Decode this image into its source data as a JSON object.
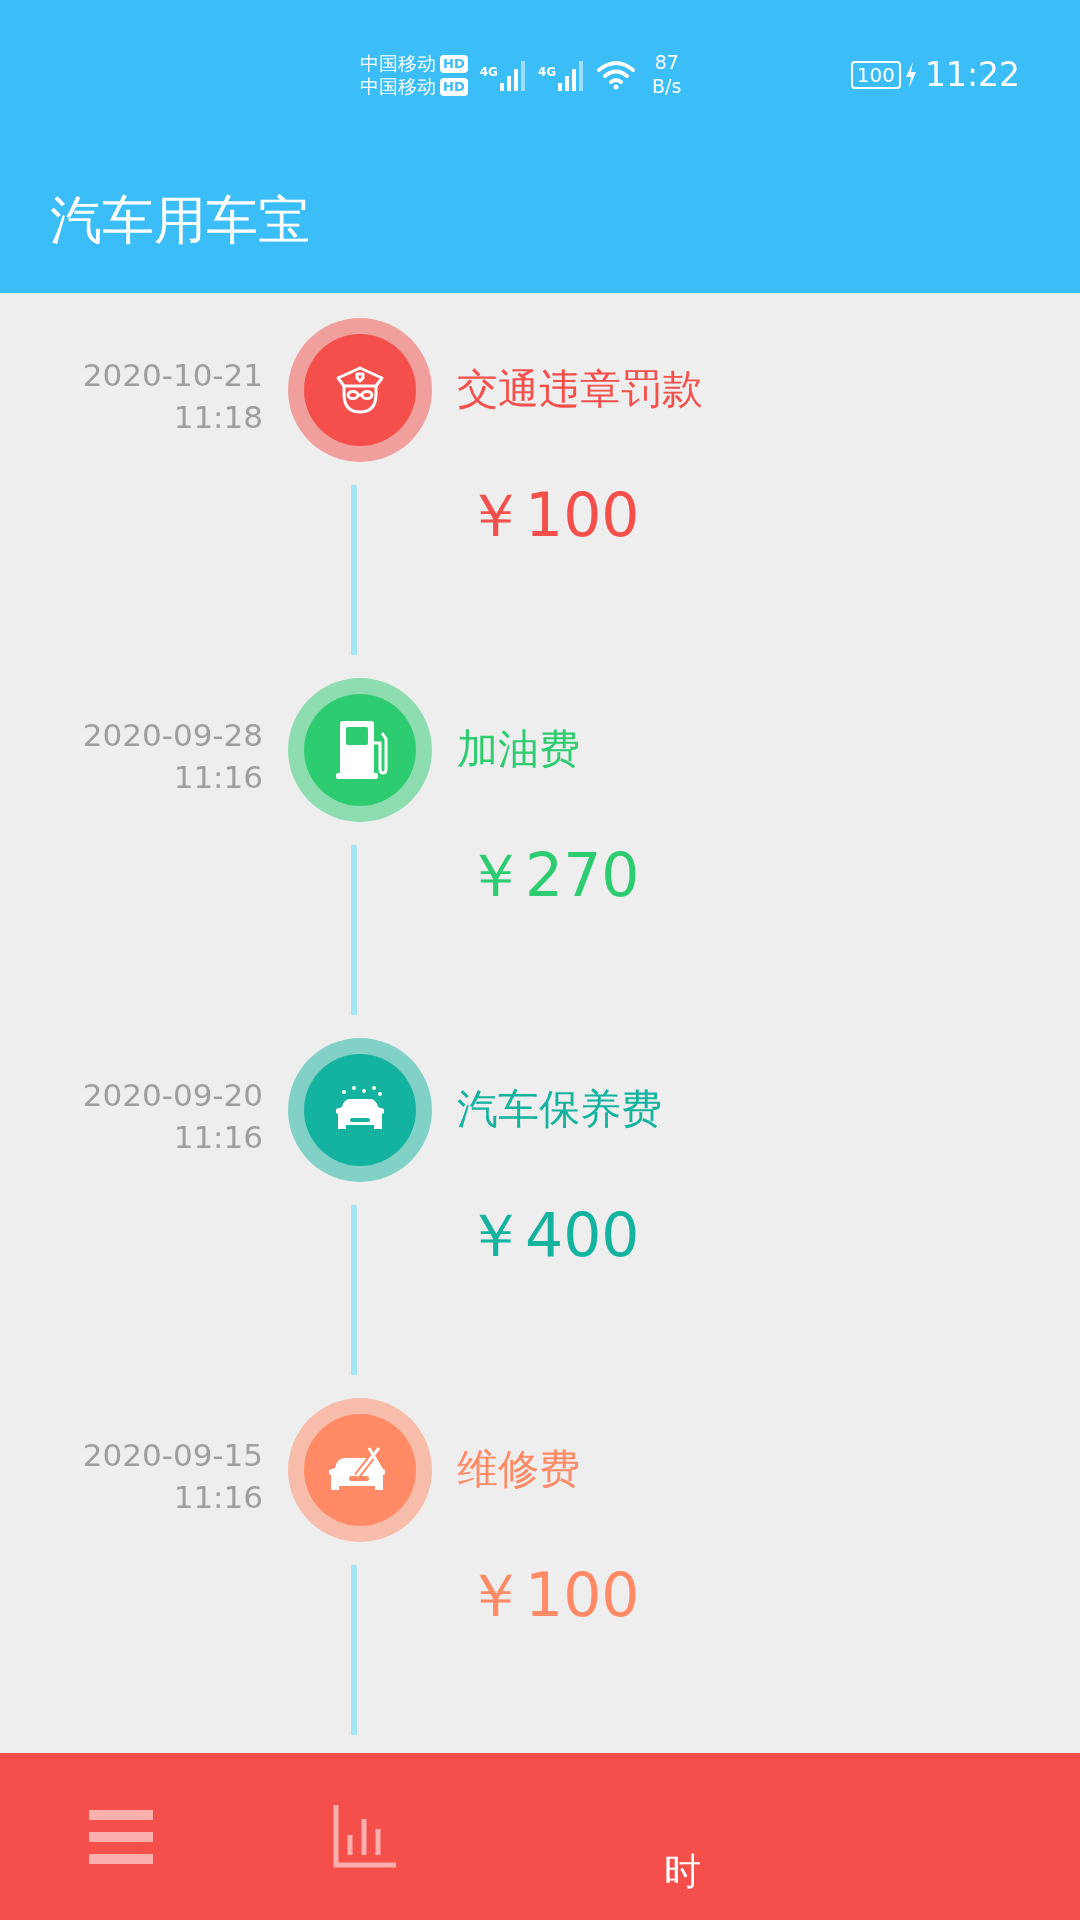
{
  "status_bar": {
    "carriers": [
      {
        "name": "中国移动",
        "badge": "HD"
      },
      {
        "name": "中国移动",
        "badge": "HD"
      }
    ],
    "networks": [
      "4G",
      "4G"
    ],
    "speed_value": "87",
    "speed_unit": "B/s",
    "battery": "100",
    "time": "11:22"
  },
  "app_bar": {
    "title": "汽车用车宝"
  },
  "timeline": [
    {
      "kind": "fine",
      "date": "2020-10-21",
      "time": "11:18",
      "title": "交通违章罚款",
      "amount": "￥100",
      "color": "#f44f4a"
    },
    {
      "kind": "fuel",
      "date": "2020-09-28",
      "time": "11:16",
      "title": "加油费",
      "amount": "￥270",
      "color": "#2ecc71"
    },
    {
      "kind": "maintenance",
      "date": "2020-09-20",
      "time": "11:16",
      "title": "汽车保养费",
      "amount": "￥400",
      "color": "#14b3a0"
    },
    {
      "kind": "repair",
      "date": "2020-09-15",
      "time": "11:16",
      "title": "维修费",
      "amount": "￥100",
      "color": "#ff8a65"
    }
  ],
  "bottom_nav": {
    "label": "时"
  }
}
